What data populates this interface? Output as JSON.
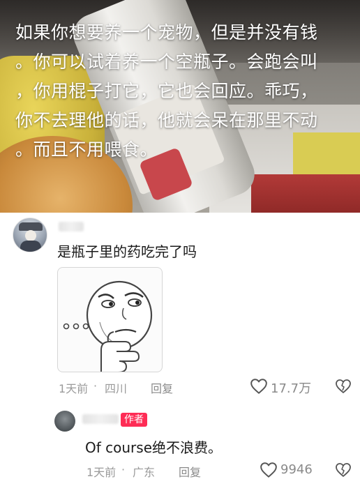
{
  "post": {
    "caption_lines": [
      "如果你想要养一个宠物，但是并没有钱",
      "。你可以试着养一个空瓶子。会跑会叫",
      "，你用棍子打它，它也会回应。乖巧，",
      "你不去理他的话，他就会呆在那里不动",
      "。而且不用喂食。"
    ]
  },
  "comment": {
    "text": "是瓶子里的药吃完了吗",
    "time": "1天前",
    "separator": "·",
    "location": "四川",
    "reply_label": "回复",
    "likes": "17.7万",
    "sticker_icon": "thinking-face-sticker"
  },
  "reply": {
    "badge": "作者",
    "text": "Of course绝不浪费。",
    "time": "1天前",
    "separator": "·",
    "location": "广东",
    "reply_label": "回复",
    "likes": "9946"
  },
  "icons": {
    "like": "heart-outline-icon",
    "dislike": "broken-heart-icon"
  },
  "colors": {
    "author_badge": "#fe2c55",
    "meta_text": "#9a9a9a"
  }
}
